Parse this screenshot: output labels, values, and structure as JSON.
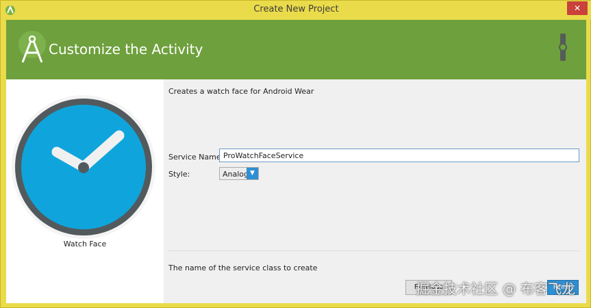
{
  "window": {
    "title": "Create New Project",
    "close_glyph": "✕"
  },
  "header": {
    "title": "Customize the Activity",
    "logo_icon": "android-studio-icon",
    "device_icon": "watch-icon",
    "bg_color": "#6ea03d"
  },
  "preview": {
    "label": "Watch Face",
    "face_color": "#0fa5dc",
    "rim_color": "#525a5e"
  },
  "form": {
    "description": "Creates a watch face for Android Wear",
    "service_name_label": "Service Name:",
    "service_name_value": "ProWatchFaceService",
    "style_label": "Style:",
    "style_value": "Analog",
    "help_text": "The name of the service class to create"
  },
  "buttons": {
    "previous": "Previous",
    "finish": "Finish"
  },
  "watermark": "掘金技术社区 @ 布客飞龙"
}
